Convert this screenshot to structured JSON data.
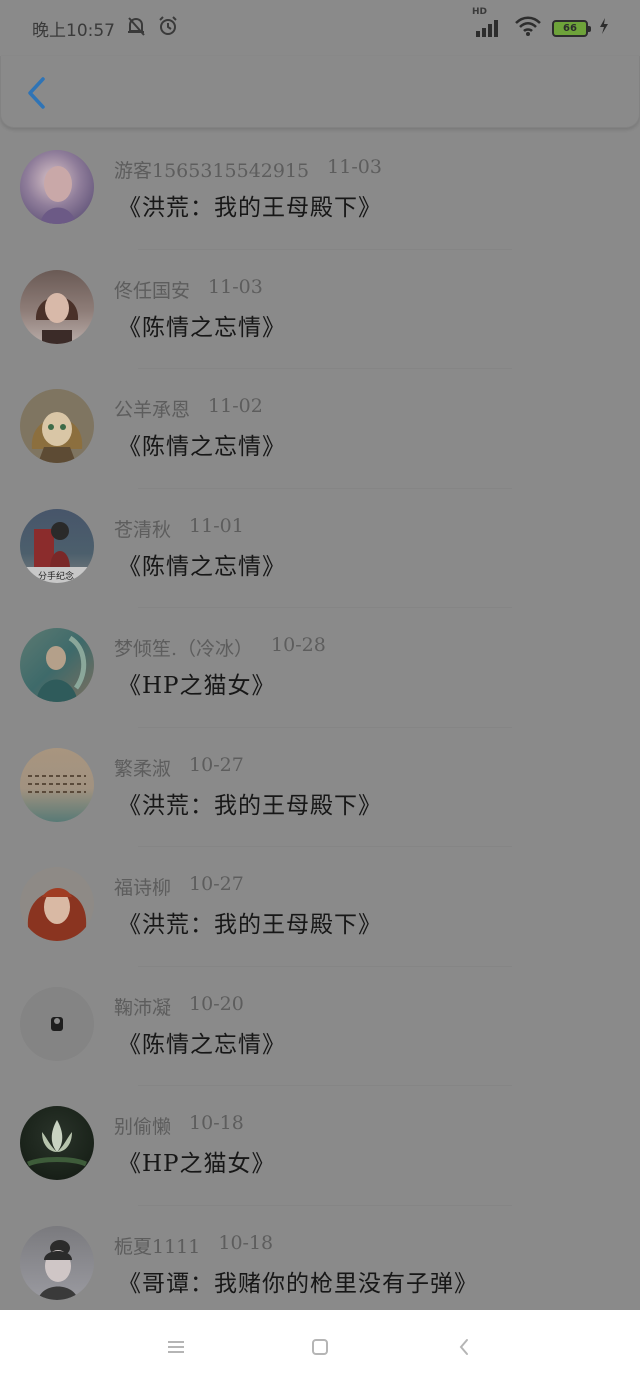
{
  "status_bar": {
    "time": "晚上10:57",
    "network": "HD",
    "battery": "66"
  },
  "colors": {
    "accent": "#2f74b6",
    "dim_overlay": "#8a8a8a"
  },
  "header": {
    "back_icon": "back-chevron-icon"
  },
  "items": [
    {
      "user": "游客1565315542915",
      "date": "11-03",
      "book": "《洪荒：我的王母殿下》"
    },
    {
      "user": "佟任国安",
      "date": "11-03",
      "book": "《陈情之忘情》"
    },
    {
      "user": "公羊承恩",
      "date": "11-02",
      "book": "《陈情之忘情》"
    },
    {
      "user": "苍清秋",
      "date": "11-01",
      "book": "《陈情之忘情》"
    },
    {
      "user": "梦倾笙.（冷冰）",
      "date": "10-28",
      "book": "《HP之猫女》"
    },
    {
      "user": "繁柔淑",
      "date": "10-27",
      "book": "《洪荒：我的王母殿下》"
    },
    {
      "user": "福诗柳",
      "date": "10-27",
      "book": "《洪荒：我的王母殿下》"
    },
    {
      "user": "鞠沛凝",
      "date": "10-20",
      "book": "《陈情之忘情》"
    },
    {
      "user": "别偷懒",
      "date": "10-18",
      "book": "《HP之猫女》"
    },
    {
      "user": "栀夏1111",
      "date": "10-18",
      "book": "《哥谭：我赌你的枪里没有子弹》"
    }
  ],
  "avatar_captions": {
    "item4": "分手纪念"
  },
  "nav_bar": {
    "menu_icon": "menu-icon",
    "home_icon": "home-square-icon",
    "back_icon": "back-triangle-icon"
  }
}
